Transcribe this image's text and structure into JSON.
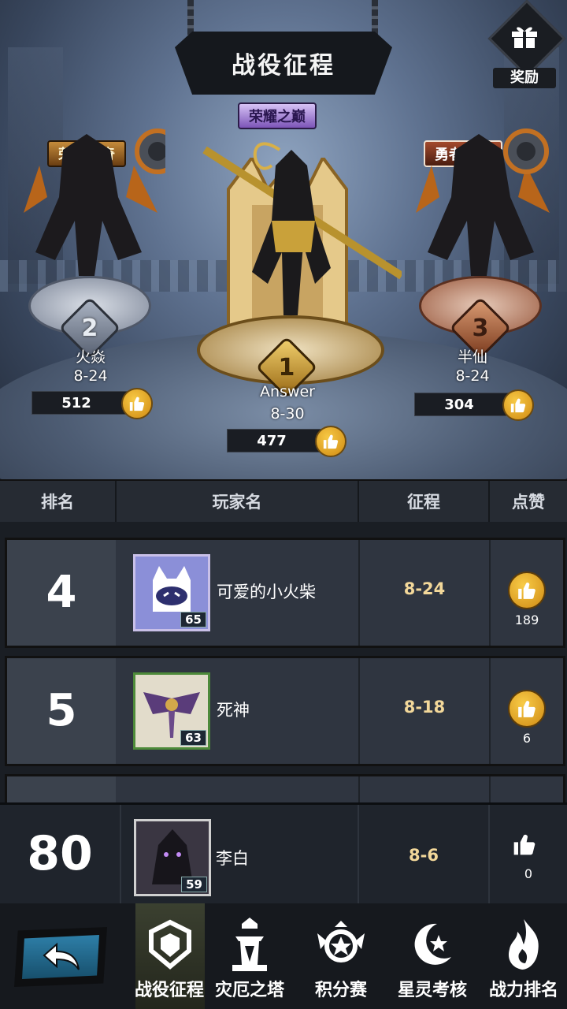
{
  "header": {
    "title": "战役征程",
    "reward_label": "奖励"
  },
  "podium": {
    "first": {
      "tag": "荣耀之巅",
      "rank": "1",
      "name": "Answer",
      "stage": "8-30",
      "likes": "477"
    },
    "second": {
      "tag": "荣耀传奇",
      "rank": "2",
      "name": "火焱",
      "stage": "8-24",
      "likes": "512"
    },
    "third": {
      "tag": "勇者守护",
      "rank": "3",
      "name": "半仙",
      "stage": "8-24",
      "likes": "304"
    }
  },
  "table": {
    "headers": {
      "rank": "排名",
      "player": "玩家名",
      "stage": "征程",
      "likes": "点赞"
    },
    "rows": [
      {
        "rank": "4",
        "level": "65",
        "name": "可爱的小火柴",
        "stage": "8-24",
        "likes": "189"
      },
      {
        "rank": "5",
        "level": "63",
        "name": "死神",
        "stage": "8-18",
        "likes": "6"
      }
    ]
  },
  "me": {
    "rank": "80",
    "level": "59",
    "name": "李白",
    "stage": "8-6",
    "likes": "0"
  },
  "nav": {
    "items": [
      {
        "label": "战役征程"
      },
      {
        "label": "灾厄之塔"
      },
      {
        "label": "积分赛"
      },
      {
        "label": "星灵考核"
      },
      {
        "label": "战力排名"
      }
    ]
  }
}
